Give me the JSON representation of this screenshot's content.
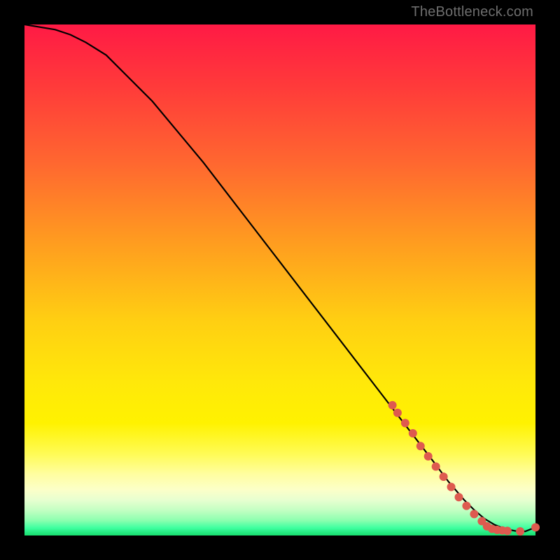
{
  "watermark": "TheBottleneck.com",
  "chart_data": {
    "type": "line",
    "title": "",
    "xlabel": "",
    "ylabel": "",
    "xlim": [
      0,
      100
    ],
    "ylim": [
      0,
      100
    ],
    "background_gradient": {
      "top": "#ff1a45",
      "mid1": "#ff9a20",
      "mid2": "#ffe80a",
      "bottom": "#16dd6e"
    },
    "series": [
      {
        "name": "bottleneck-curve",
        "color": "#000000",
        "x": [
          0,
          3,
          6,
          9,
          12,
          16,
          20,
          25,
          30,
          35,
          40,
          45,
          50,
          55,
          60,
          65,
          70,
          75,
          80,
          83,
          86,
          88,
          90,
          92,
          94,
          96,
          98,
          100
        ],
        "y": [
          100,
          99.5,
          99,
          98,
          96.5,
          94,
          90,
          85,
          79,
          73,
          66.5,
          60,
          53.5,
          47,
          40.5,
          34,
          27.5,
          21,
          14.5,
          10.5,
          7,
          5,
          3.3,
          2.1,
          1.3,
          0.9,
          0.8,
          1.6
        ]
      }
    ],
    "markers": {
      "name": "highlight-dots",
      "color": "#de5a4f",
      "radius": 6,
      "points": [
        {
          "x": 72,
          "y": 25.5
        },
        {
          "x": 73,
          "y": 24
        },
        {
          "x": 74.5,
          "y": 22
        },
        {
          "x": 76,
          "y": 20
        },
        {
          "x": 77.5,
          "y": 17.5
        },
        {
          "x": 79,
          "y": 15.5
        },
        {
          "x": 80.5,
          "y": 13.5
        },
        {
          "x": 82,
          "y": 11.5
        },
        {
          "x": 83.5,
          "y": 9.5
        },
        {
          "x": 85,
          "y": 7.5
        },
        {
          "x": 86.5,
          "y": 5.8
        },
        {
          "x": 88,
          "y": 4.2
        },
        {
          "x": 89.5,
          "y": 2.8
        },
        {
          "x": 90.5,
          "y": 1.8
        },
        {
          "x": 91.5,
          "y": 1.3
        },
        {
          "x": 92.5,
          "y": 1.1
        },
        {
          "x": 93.5,
          "y": 1.0
        },
        {
          "x": 94.5,
          "y": 0.9
        },
        {
          "x": 97,
          "y": 0.8
        },
        {
          "x": 100,
          "y": 1.6
        }
      ]
    }
  }
}
